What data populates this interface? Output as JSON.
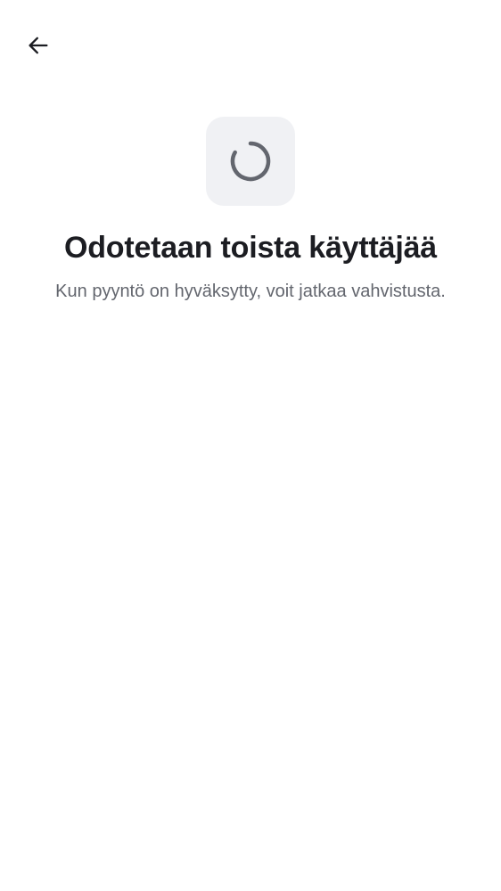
{
  "header": {
    "back_icon": "arrow-left-icon"
  },
  "status": {
    "icon": "loading-spinner-icon",
    "title": "Odotetaan toista käyttäjää",
    "subtitle": "Kun pyyntö on hyväksytty, voit jatkaa vahvistusta."
  },
  "colors": {
    "background": "#ffffff",
    "tile_background": "#f0f1f4",
    "spinner": "#63666e",
    "title_text": "#1c1d22",
    "subtitle_text": "#63666e"
  }
}
